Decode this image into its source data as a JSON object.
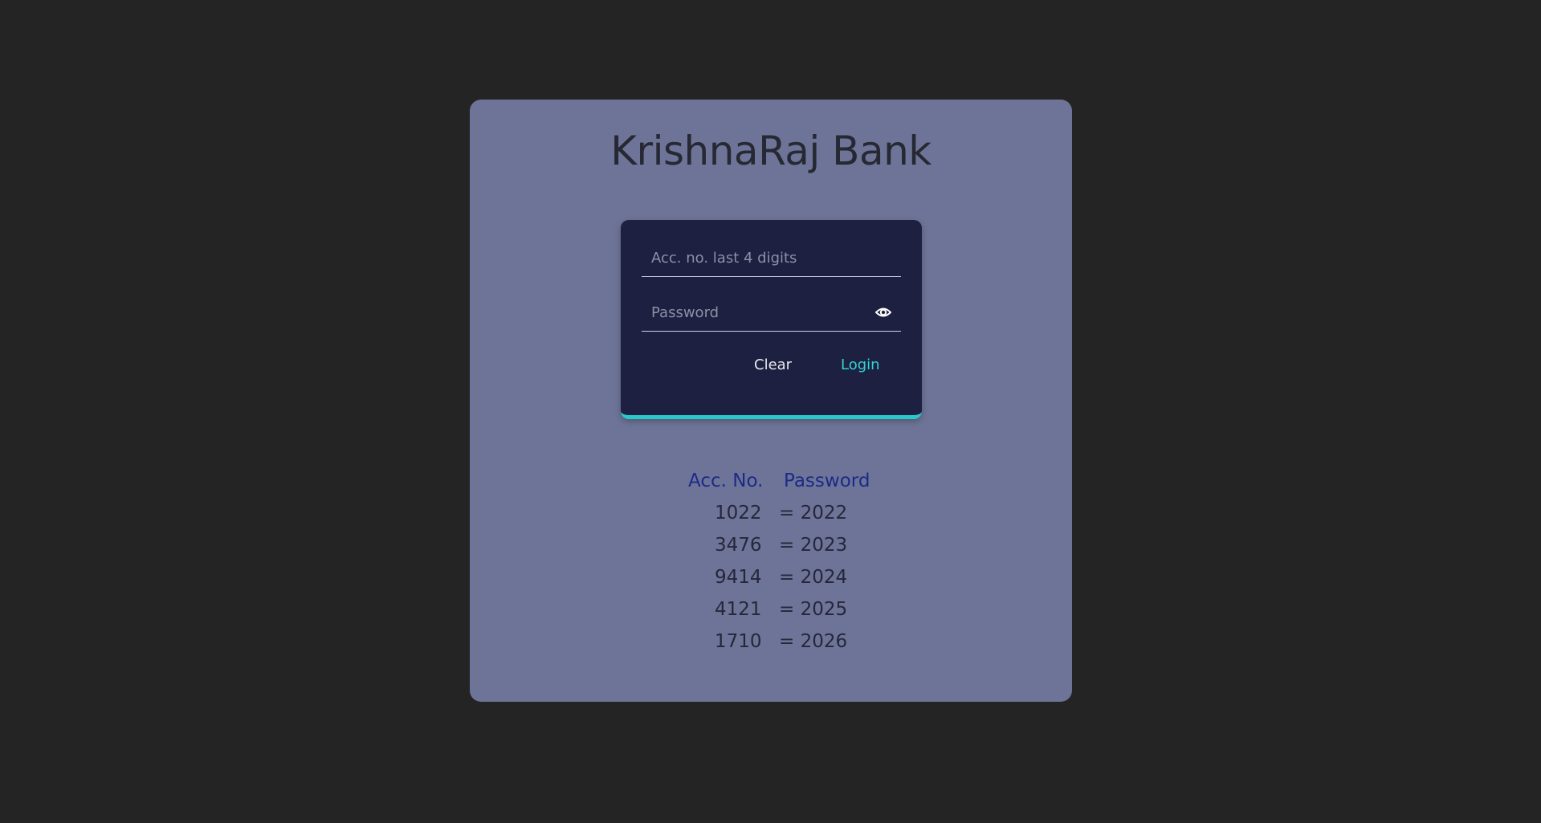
{
  "title": "KrishnaRaj Bank",
  "login_form": {
    "account_placeholder": "Acc. no. last 4 digits",
    "password_placeholder": "Password",
    "show_password_icon": "eye-icon",
    "clear_label": "Clear",
    "login_label": "Login"
  },
  "credentials": {
    "headers": {
      "acc": "Acc. No.",
      "password": "Password"
    },
    "rows": [
      {
        "acc": "1022",
        "password": "= 2022"
      },
      {
        "acc": "3476",
        "password": "= 2023"
      },
      {
        "acc": "9414",
        "password": "= 2024"
      },
      {
        "acc": "4121",
        "password": "= 2025"
      },
      {
        "acc": "1710",
        "password": "= 2026"
      }
    ]
  },
  "colors": {
    "page_background": "#242424",
    "card_background": "#6e7497",
    "form_background": "#1d2040",
    "accent": "#29c9c9",
    "header_text": "#1c2a87"
  }
}
